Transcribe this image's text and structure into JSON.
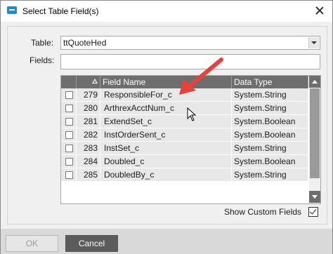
{
  "window": {
    "title": "Select Table Field(s)"
  },
  "form": {
    "table_label": "Table:",
    "table_value": "ttQuoteHed",
    "fields_label": "Fields:",
    "fields_value": ""
  },
  "grid": {
    "columns": [
      "",
      "",
      "Field Name",
      "Data Type"
    ],
    "rows": [
      {
        "num": "279",
        "field": "ResponsibleFor_c",
        "type": "System.String"
      },
      {
        "num": "280",
        "field": "ArthrexAcctNum_c",
        "type": "System.String"
      },
      {
        "num": "281",
        "field": "ExtendSet_c",
        "type": "System.Boolean"
      },
      {
        "num": "282",
        "field": "InstOrderSent_c",
        "type": "System.Boolean"
      },
      {
        "num": "283",
        "field": "InstSet_c",
        "type": "System.String"
      },
      {
        "num": "284",
        "field": "Doubled_c",
        "type": "System.Boolean"
      },
      {
        "num": "285",
        "field": "DoubledBy_c",
        "type": "System.String"
      }
    ]
  },
  "options": {
    "show_custom_fields_label": "Show Custom Fields",
    "show_custom_fields_checked": true
  },
  "buttons": {
    "ok": "OK",
    "cancel": "Cancel"
  },
  "colors": {
    "accent": "#1a8fd6",
    "header": "#6e6e6e",
    "annotation_arrow": "#e8403a"
  }
}
